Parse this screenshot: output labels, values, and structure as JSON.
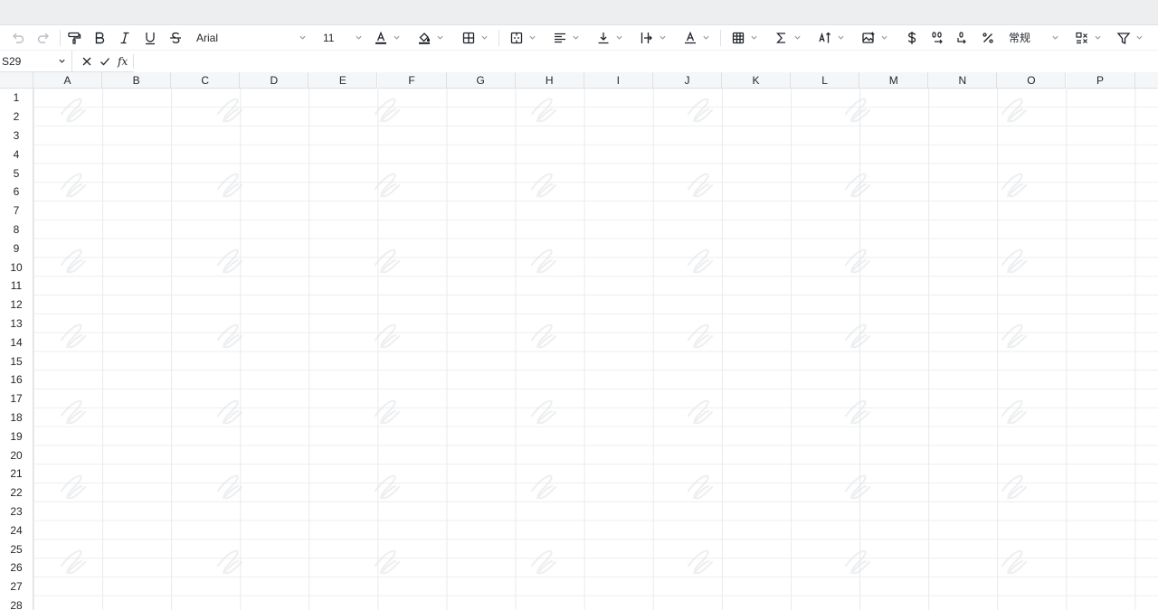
{
  "toolbar": {
    "undo_icon": "undo-icon",
    "redo_icon": "redo-icon",
    "font_name": "Arial",
    "font_size": "11",
    "number_format": "常规",
    "icons": [
      "paint-format-icon",
      "bold-icon",
      "italic-icon",
      "underline-icon",
      "strikethrough-icon",
      "font-color-icon",
      "fill-color-icon",
      "borders-icon",
      "merge-cells-icon",
      "horizontal-align-icon",
      "vertical-align-icon",
      "text-wrap-icon",
      "text-rotate-icon",
      "table-format-icon",
      "sum-icon",
      "sort-icon",
      "insert-image-icon",
      "currency-icon",
      "decimal-increase-icon",
      "decimal-decrease-icon",
      "percent-icon",
      "conditional-format-icon",
      "filter-icon"
    ]
  },
  "formula_bar": {
    "cell_ref": "S29",
    "fx_label": "fx",
    "value": ""
  },
  "grid": {
    "columns": [
      "A",
      "B",
      "C",
      "D",
      "E",
      "F",
      "G",
      "H",
      "I",
      "J",
      "K",
      "L",
      "M",
      "N",
      "O",
      "P"
    ],
    "rows": [
      "1",
      "2",
      "3",
      "4",
      "5",
      "6",
      "7",
      "8",
      "9",
      "10",
      "11",
      "12",
      "13",
      "14",
      "15",
      "16",
      "17",
      "18",
      "19",
      "20",
      "21",
      "22",
      "23",
      "24",
      "25",
      "26",
      "27",
      "28"
    ]
  },
  "colors": {
    "grid_line": "#e8eaed",
    "header_bg": "#f5f6f7",
    "text": "#1f2329",
    "watermark": "#e6e8eb"
  }
}
